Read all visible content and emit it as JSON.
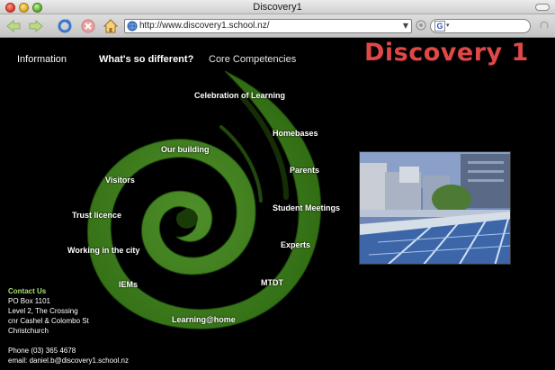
{
  "window": {
    "title": "Discovery1"
  },
  "toolbar": {
    "url": "http://www.discovery1.school.nz/"
  },
  "nav": {
    "items": [
      {
        "label": "Information"
      },
      {
        "label": "What's so different?"
      },
      {
        "label": "Core Competencies"
      }
    ]
  },
  "logo": {
    "text": "Discovery 1",
    "color": "#e04848"
  },
  "koru": {
    "links": [
      {
        "label": "Celebration of Learning"
      },
      {
        "label": "Homebases"
      },
      {
        "label": "Our building"
      },
      {
        "label": "Parents"
      },
      {
        "label": "Visitors"
      },
      {
        "label": "Student Meetings"
      },
      {
        "label": "Trust licence"
      },
      {
        "label": "Experts"
      },
      {
        "label": "Working in the city"
      },
      {
        "label": "MTDT"
      },
      {
        "label": "IEMs"
      },
      {
        "label": "Learning@home"
      }
    ],
    "color": "#3f7a1c"
  },
  "contact": {
    "heading": "Contact Us",
    "lines": [
      "PO Box 1101",
      "Level 2, The Crossing",
      "cnr Cashel & Colombo St",
      "Christchurch"
    ],
    "phone": "Phone (03) 365 4678",
    "email": "email:  daniel.b@discovery1.school.nz"
  },
  "icons": {
    "back": "back-arrow-icon",
    "forward": "forward-arrow-icon",
    "reload": "reload-icon",
    "stop": "stop-icon",
    "home": "home-icon",
    "site": "globe-icon",
    "go": "go-icon",
    "search_engine": "google-icon"
  }
}
